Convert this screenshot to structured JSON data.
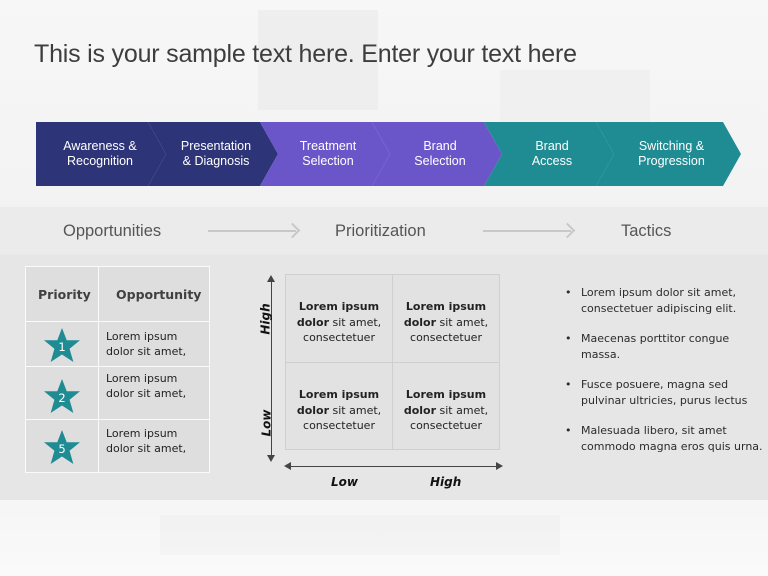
{
  "title": "This is your sample text here. Enter your text here",
  "process": {
    "steps": [
      {
        "label": "Awareness &\nRecognition",
        "color": "#2e3478"
      },
      {
        "label": "Presentation\n& Diagnosis",
        "color": "#2e3478"
      },
      {
        "label": "Treatment\nSelection",
        "color": "#6b56c9"
      },
      {
        "label": "Brand\nSelection",
        "color": "#6b56c9"
      },
      {
        "label": "Brand\nAccess",
        "color": "#1f8c93"
      },
      {
        "label": "Switching &\nProgression",
        "color": "#1f8c93"
      }
    ]
  },
  "stages": {
    "opportunities": "Opportunities",
    "prioritization": "Prioritization",
    "tactics": "Tactics"
  },
  "priority_table": {
    "headers": [
      "Priority",
      "Opportunity"
    ],
    "star_color": "#1f8c93",
    "rows": [
      {
        "priority": "1",
        "opportunity": "Lorem ipsum\ndolor sit amet,"
      },
      {
        "priority": "2",
        "opportunity": "Lorem ipsum\ndolor sit amet,"
      },
      {
        "priority": "5",
        "opportunity": "Lorem ipsum\ndolor sit amet,"
      }
    ]
  },
  "matrix": {
    "y_axis": {
      "high": "High",
      "low": "Low"
    },
    "x_axis": {
      "low": "Low",
      "high": "High"
    },
    "quadrants": [
      {
        "bold": "Lorem ipsum dolor",
        "rest": " sit amet, consectetuer"
      },
      {
        "bold": "Lorem ipsum dolor",
        "rest": " sit amet, consectetuer"
      },
      {
        "bold": "Lorem ipsum dolor",
        "rest": " sit amet, consectetuer"
      },
      {
        "bold": "Lorem ipsum dolor",
        "rest": " sit amet, consectetuer"
      }
    ]
  },
  "tactics": [
    "Lorem ipsum dolor sit amet,\nconsectetuer adipiscing elit.",
    "Maecenas porttitor congue\nmassa.",
    "Fusce posuere, magna sed\npulvinar ultricies, purus lectus",
    "Malesuada libero, sit amet\ncommodo magna eros quis urna."
  ]
}
